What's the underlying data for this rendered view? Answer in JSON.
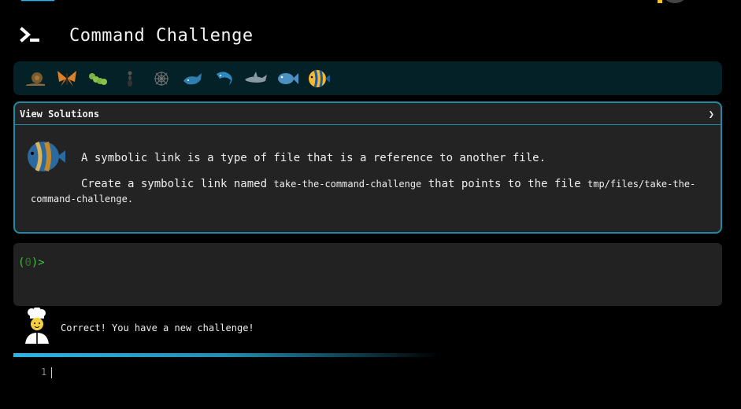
{
  "header": {
    "title": "Command Challenge"
  },
  "icon_bar": {
    "icons": [
      "snail-icon",
      "butterfly-icon",
      "caterpillar-icon",
      "ant-icon",
      "spider-web-icon",
      "whale-icon",
      "dolphin-icon",
      "shark-icon",
      "fish-icon",
      "tropical-fish-icon"
    ]
  },
  "panel": {
    "toggle_label": "View Solutions",
    "toggle_arrow": "❯",
    "line1": "A symbolic link is a type of file that is a reference to another file.",
    "line2_pre": "Create a symbolic link named ",
    "line2_code1": "take-the-command-challenge",
    "line2_mid": " that points to the file ",
    "line2_code2": "tmp/files/take-the-command-challenge",
    "line2_post": "."
  },
  "terminal": {
    "prompt_open": "(",
    "prompt_code": "0",
    "prompt_close": ")>"
  },
  "feedback": {
    "message": "Correct! You have a new challenge!"
  },
  "editor": {
    "line_number": "1"
  },
  "colors": {
    "accent": "#1e8aa6",
    "prompt_green": "#3ec23e",
    "icon_bar_bg": "#052128"
  }
}
